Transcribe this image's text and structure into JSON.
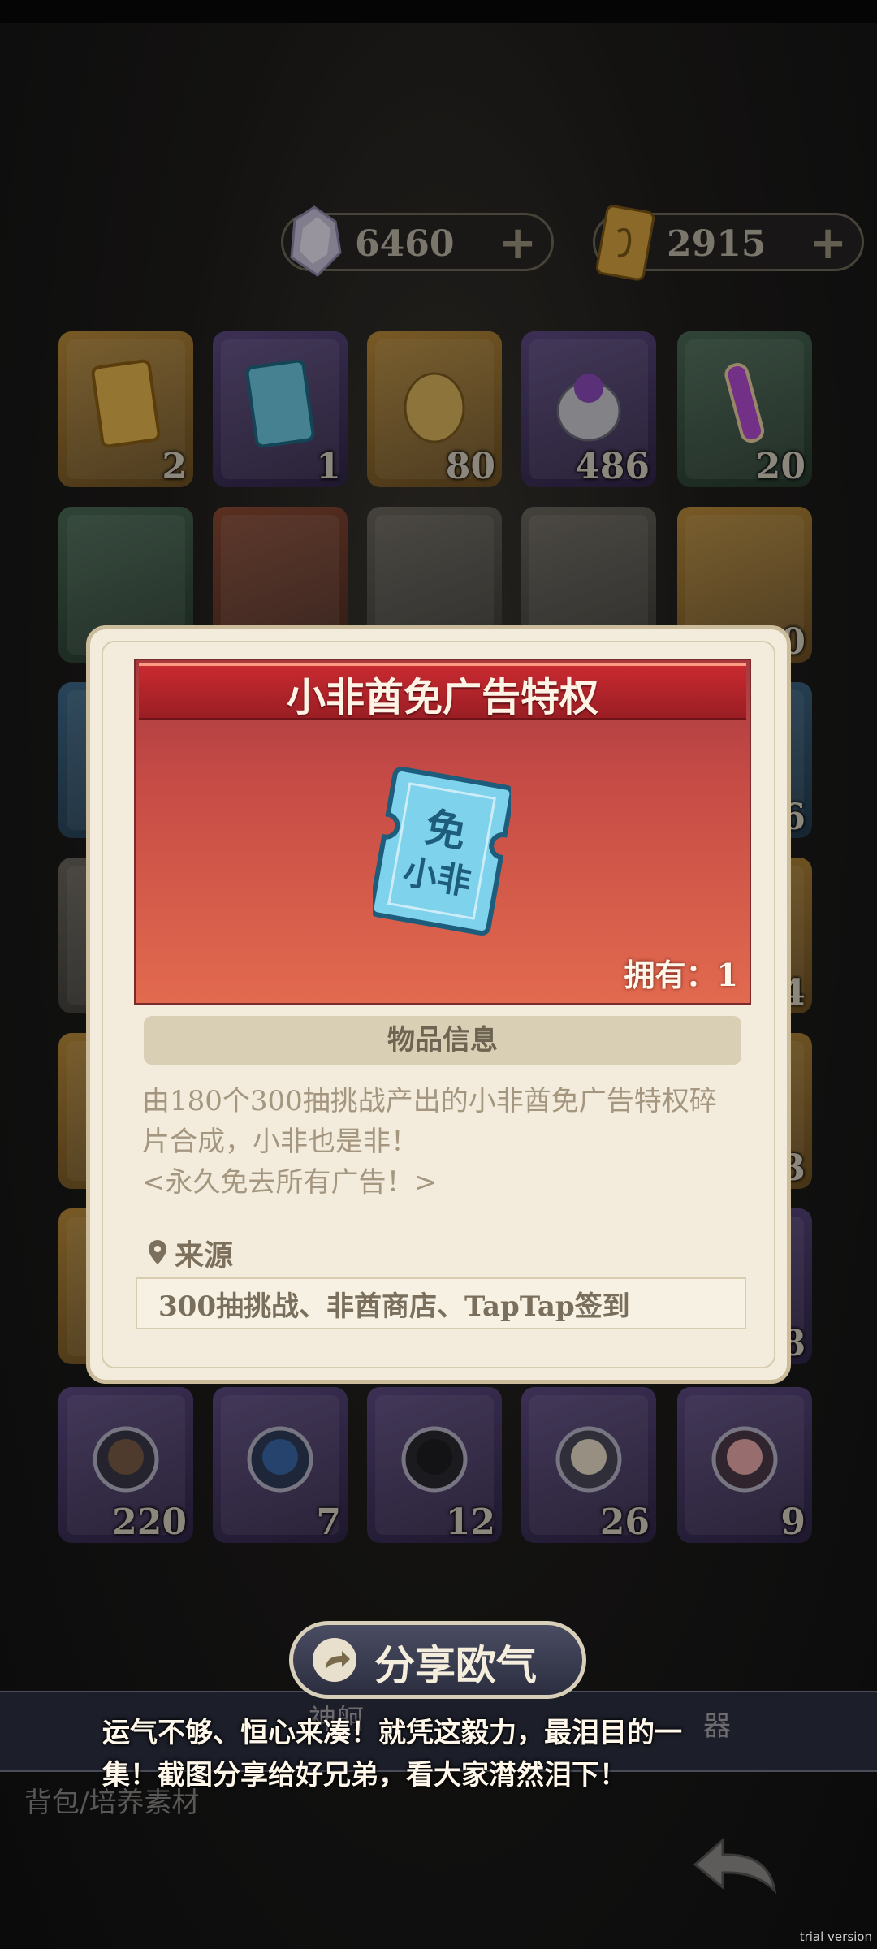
{
  "currency": {
    "crystals": "6460",
    "tickets": "2915",
    "plus": "+"
  },
  "grid": [
    {
      "name": "ticket-free-gold",
      "count": "2",
      "color": "gold"
    },
    {
      "name": "ticket-free-blue",
      "count": "1",
      "color": "purple"
    },
    {
      "name": "egg-gold",
      "count": "80",
      "color": "gold"
    },
    {
      "name": "egg-purple",
      "count": "486",
      "color": "purple"
    },
    {
      "name": "potion-purple",
      "count": "20",
      "color": "green"
    }
  ],
  "portraits": [
    {
      "count": "220"
    },
    {
      "count": "7"
    },
    {
      "count": "12"
    },
    {
      "count": "26"
    },
    {
      "count": "9"
    }
  ],
  "edge_counts": {
    "r2": "0",
    "r3": "6",
    "r4": "4",
    "r5": "3",
    "r6": "8"
  },
  "modal": {
    "title": "小非酋免广告特权",
    "owned": "拥有：1",
    "ticket_text": [
      "免",
      "小非"
    ],
    "info_header": "物品信息",
    "description_line1": "由180个300抽挑战产出的小非酋免广告特权碎",
    "description_line2": "片合成，小非也是非！",
    "description_line3": "<永久免去所有广告！>",
    "source_label": "来源",
    "source_value": "300抽挑战、非酋商店、TapTap签到"
  },
  "bottom": {
    "share_label": "分享欧气",
    "caption_line1": "运气不够、恒心来凑！就凭这毅力，最泪目的一",
    "caption_line2": "集！截图分享给好兄弟，看大家潸然泪下！",
    "tab_shenqi": "神舸",
    "tab_qi": "器",
    "bag_label": "背包/培养素材",
    "trial": "trial version"
  },
  "colors": {
    "modal_bg": "#f3ecdc",
    "hero_red": "#c64b46",
    "ribbon_red": "#c82a30"
  }
}
